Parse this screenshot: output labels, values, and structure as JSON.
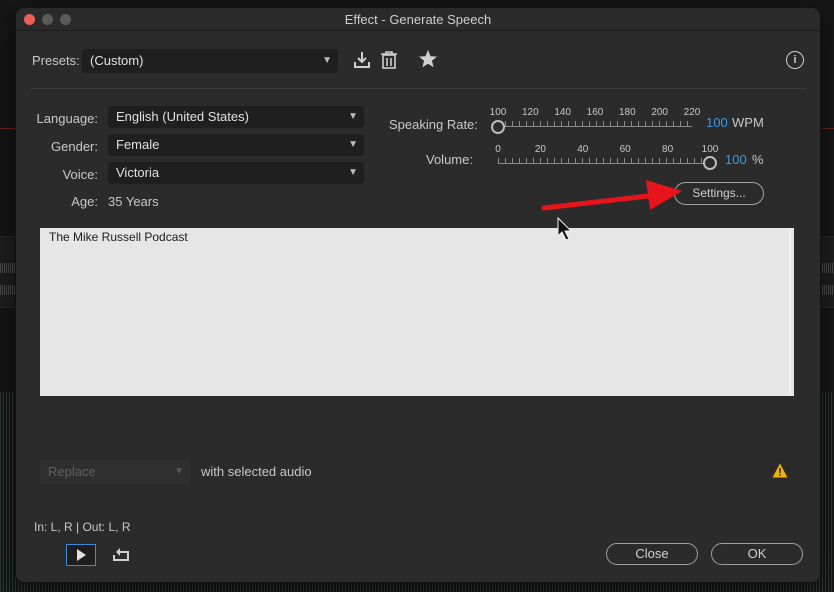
{
  "window": {
    "title": "Effect - Generate Speech"
  },
  "presets": {
    "label": "Presets:",
    "value": "(Custom)"
  },
  "icons": {
    "save": "download-icon",
    "delete": "trash-icon",
    "favorite": "star-icon",
    "info": "info-icon",
    "warning": "warning-icon",
    "play": "play-icon",
    "loop": "loop-icon",
    "annotation_arrow": "red-arrow"
  },
  "voice_settings": {
    "language_label": "Language:",
    "language_value": "English (United States)",
    "gender_label": "Gender:",
    "gender_value": "Female",
    "voice_label": "Voice:",
    "voice_value": "Victoria",
    "age_label": "Age:",
    "age_value": "35 Years"
  },
  "speaking_rate": {
    "label": "Speaking Rate:",
    "ticks": [
      "100",
      "120",
      "140",
      "160",
      "180",
      "200",
      "220"
    ],
    "value": "100",
    "unit": "WPM",
    "level": 0
  },
  "volume": {
    "label": "Volume:",
    "ticks": [
      "0",
      "20",
      "40",
      "60",
      "80",
      "100"
    ],
    "value": "100",
    "unit": "%",
    "level": 1
  },
  "settings_button": "Settings...",
  "text_input": "The Mike Russell Podcast",
  "output": {
    "mode": "Replace",
    "suffix": "with selected audio"
  },
  "io_label": "In: L, R | Out: L, R",
  "buttons": {
    "close": "Close",
    "ok": "OK"
  },
  "colors": {
    "accent_blue": "#3d9be6",
    "warning_yellow": "#f0b400",
    "arrow_red": "#e8141b",
    "close_dot": "#ec5f57"
  }
}
